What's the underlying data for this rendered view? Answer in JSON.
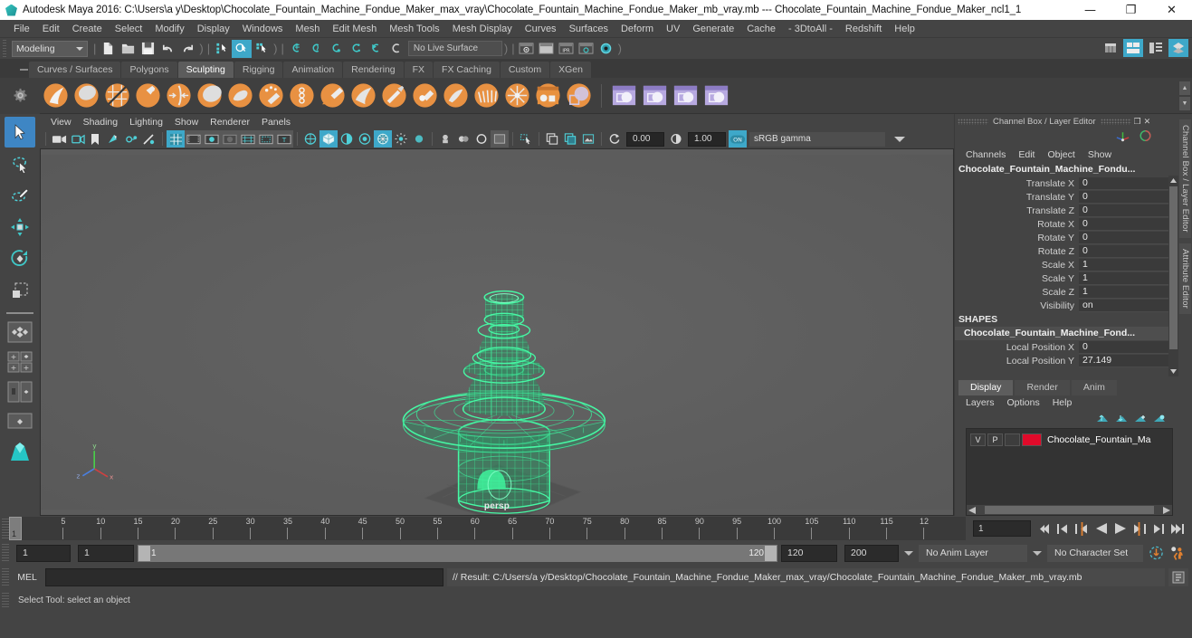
{
  "titlebar": {
    "app_title": "Autodesk Maya 2016: C:\\Users\\a y\\Desktop\\Chocolate_Fountain_Machine_Fondue_Maker_max_vray\\Chocolate_Fountain_Machine_Fondue_Maker_mb_vray.mb  ---  Chocolate_Fountain_Machine_Fondue_Maker_ncl1_1",
    "minimize": "—",
    "maximize": "❐",
    "close": "✕"
  },
  "menubar": {
    "items": [
      {
        "label": "File"
      },
      {
        "label": "Edit"
      },
      {
        "label": "Create"
      },
      {
        "label": "Select"
      },
      {
        "label": "Modify"
      },
      {
        "label": "Display"
      },
      {
        "label": "Windows"
      },
      {
        "label": "Mesh"
      },
      {
        "label": "Edit Mesh"
      },
      {
        "label": "Mesh Tools"
      },
      {
        "label": "Mesh Display"
      },
      {
        "label": "Curves"
      },
      {
        "label": "Surfaces"
      },
      {
        "label": "Deform"
      },
      {
        "label": "UV"
      },
      {
        "label": "Generate"
      },
      {
        "label": "Cache"
      },
      {
        "label": "- 3DtoAll -"
      },
      {
        "label": "Redshift"
      },
      {
        "label": "Help"
      }
    ]
  },
  "statusline": {
    "mode": "Modeling",
    "live_surface": "No Live Surface",
    "icons": [
      "new-scene-icon",
      "open-scene-icon",
      "save-scene-icon",
      "undo-icon",
      "redo-icon",
      "select-by-hierarchy-icon",
      "select-by-object-icon",
      "select-by-component-icon",
      "snap-to-grid-icon",
      "snap-to-curve-icon",
      "snap-to-point-icon",
      "snap-to-projected-center-icon",
      "snap-to-view-plane-icon",
      "make-live-icon",
      "render-view-icon",
      "render-current-frame-icon",
      "ipr-render-icon",
      "render-settings-icon",
      "hypershade-icon"
    ],
    "right_icons": [
      "show-hide-modeling-toolkit-icon",
      "show-hide-attribute-editor-icon",
      "show-hide-tool-settings-icon",
      "show-hide-channel-box-icon"
    ]
  },
  "shelf": {
    "tabs": [
      {
        "label": "Curves / Surfaces",
        "active": false
      },
      {
        "label": "Polygons",
        "active": false
      },
      {
        "label": "Sculpting",
        "active": true
      },
      {
        "label": "Rigging",
        "active": false
      },
      {
        "label": "Animation",
        "active": false
      },
      {
        "label": "Rendering",
        "active": false
      },
      {
        "label": "FX",
        "active": false
      },
      {
        "label": "FX Caching",
        "active": false
      },
      {
        "label": "Custom",
        "active": false
      },
      {
        "label": "XGen",
        "active": false
      }
    ],
    "icons": [
      "sculpt-tool-icon",
      "smooth-tool-icon",
      "relax-tool-icon",
      "grab-tool-icon",
      "pinch-tool-icon",
      "flatten-tool-icon",
      "foamy-tool-icon",
      "spray-tool-icon",
      "repeat-tool-icon",
      "imprint-tool-icon",
      "wax-tool-icon",
      "scrape-tool-icon",
      "fill-tool-icon",
      "knife-tool-icon",
      "smear-tool-icon",
      "bulge-tool-icon",
      "amplify-tool-icon",
      "freeze-tool-icon",
      "freeze-selection-icon",
      "sculpt-settings-icon",
      "mirror-sculpt-icon",
      "sculpt-layers-icon"
    ]
  },
  "toolbox": {
    "tools": [
      {
        "name": "select-tool",
        "selected": true
      },
      {
        "name": "lasso-select-tool",
        "selected": false
      },
      {
        "name": "paint-select-tool",
        "selected": false
      },
      {
        "name": "move-tool",
        "selected": false
      },
      {
        "name": "rotate-tool",
        "selected": false
      },
      {
        "name": "scale-tool",
        "selected": false
      }
    ],
    "layouts": [
      "single-perspective-layout",
      "four-view-layout",
      "two-pane-layout",
      "persp-outliner-layout",
      "hypershade-layout"
    ]
  },
  "viewport": {
    "menus": [
      "View",
      "Shading",
      "Lighting",
      "Show",
      "Renderer",
      "Panels"
    ],
    "camera_label": "persp",
    "exposure": "0.00",
    "gamma": "1.00",
    "color_space": "sRGB gamma",
    "toolbar_icons": [
      "camera-attributes-icon",
      "bookmark-icon",
      "image-plane-icon",
      "two-sided-lighting-icon",
      "shadows-icon",
      "ambient-occlusion-icon",
      "grid-icon",
      "film-gate-icon",
      "resolution-gate-icon",
      "gate-mask-icon",
      "field-chart-icon",
      "safe-action-icon",
      "safe-title-icon",
      "wireframe-icon",
      "smooth-shade-all-icon",
      "shaded-wireframe-icon",
      "textured-icon",
      "use-all-lights-icon",
      "xray-icon",
      "xray-joints-icon",
      "xray-active-components-icon",
      "isolate-select-icon",
      "snapshot-icon"
    ]
  },
  "channel_box": {
    "panel_title": "Channel Box / Layer Editor",
    "menus": [
      "Channels",
      "Edit",
      "Object",
      "Show"
    ],
    "object_name": "Chocolate_Fountain_Machine_Fondu...",
    "transform_channels": [
      {
        "label": "Translate X",
        "value": "0"
      },
      {
        "label": "Translate Y",
        "value": "0"
      },
      {
        "label": "Translate Z",
        "value": "0"
      },
      {
        "label": "Rotate X",
        "value": "0"
      },
      {
        "label": "Rotate Y",
        "value": "0"
      },
      {
        "label": "Rotate Z",
        "value": "0"
      },
      {
        "label": "Scale X",
        "value": "1"
      },
      {
        "label": "Scale Y",
        "value": "1"
      },
      {
        "label": "Scale Z",
        "value": "1"
      },
      {
        "label": "Visibility",
        "value": "on"
      }
    ],
    "shapes_header": "SHAPES",
    "shape_name": "Chocolate_Fountain_Machine_Fond...",
    "shape_channels": [
      {
        "label": "Local Position X",
        "value": "0"
      },
      {
        "label": "Local Position Y",
        "value": "27.149"
      }
    ]
  },
  "layer_editor": {
    "tabs": [
      {
        "label": "Display",
        "active": true
      },
      {
        "label": "Render",
        "active": false
      },
      {
        "label": "Anim",
        "active": false
      }
    ],
    "menus": [
      "Layers",
      "Options",
      "Help"
    ],
    "buttons": [
      "move-layer-up-icon",
      "move-layer-down-icon",
      "create-new-layer-icon",
      "create-layer-from-selected-icon"
    ],
    "layers": [
      {
        "visibility": "V",
        "playback": "P",
        "state": "",
        "color": "#e00a2a",
        "name": "Chocolate_Fountain_Ma"
      }
    ]
  },
  "dock_labels": [
    "Channel Box / Layer Editor",
    "Attribute Editor"
  ],
  "timeline": {
    "current_frame": "1",
    "ticks": [
      {
        "label": "5",
        "frame": 5
      },
      {
        "label": "10",
        "frame": 10
      },
      {
        "label": "15",
        "frame": 15
      },
      {
        "label": "20",
        "frame": 20
      },
      {
        "label": "25",
        "frame": 25
      },
      {
        "label": "30",
        "frame": 30
      },
      {
        "label": "35",
        "frame": 35
      },
      {
        "label": "40",
        "frame": 40
      },
      {
        "label": "45",
        "frame": 45
      },
      {
        "label": "50",
        "frame": 50
      },
      {
        "label": "55",
        "frame": 55
      },
      {
        "label": "60",
        "frame": 60
      },
      {
        "label": "65",
        "frame": 65
      },
      {
        "label": "70",
        "frame": 70
      },
      {
        "label": "75",
        "frame": 75
      },
      {
        "label": "80",
        "frame": 80
      },
      {
        "label": "85",
        "frame": 85
      },
      {
        "label": "90",
        "frame": 90
      },
      {
        "label": "95",
        "frame": 95
      },
      {
        "label": "100",
        "frame": 100
      },
      {
        "label": "105",
        "frame": 105
      },
      {
        "label": "110",
        "frame": 110
      },
      {
        "label": "115",
        "frame": 115
      },
      {
        "label": "12",
        "frame": 120
      }
    ],
    "frame_field": "1",
    "playback_buttons": [
      "go-to-start-icon",
      "step-back-frame-icon",
      "step-back-key-icon",
      "play-backwards-icon",
      "play-forwards-icon",
      "step-forward-key-icon",
      "step-forward-frame-icon",
      "go-to-end-icon"
    ]
  },
  "range": {
    "anim_start": "1",
    "range_start": "1",
    "slider_start_label": "1",
    "slider_end_label": "120",
    "range_end": "120",
    "anim_end": "200",
    "anim_layer": "No Anim Layer",
    "character_set": "No Character Set",
    "auto_key": "auto-keyframe-icon",
    "anim_prefs": "animation-preferences-icon"
  },
  "command_line": {
    "language_label": "MEL",
    "input_value": "",
    "result_text": "// Result: C:/Users/a y/Desktop/Chocolate_Fountain_Machine_Fondue_Maker_max_vray/Chocolate_Fountain_Machine_Fondue_Maker_mb_vray.mb",
    "script_editor_button": "script-editor-icon"
  },
  "help_line": {
    "text": "Select Tool: select an object"
  },
  "colors": {
    "accent_blue": "#3ea8c9",
    "wireframe_green": "#3ef09a",
    "layer_red": "#e00a2a",
    "panel_bg": "#444444",
    "viewport_bg": "#5c5c5c"
  }
}
